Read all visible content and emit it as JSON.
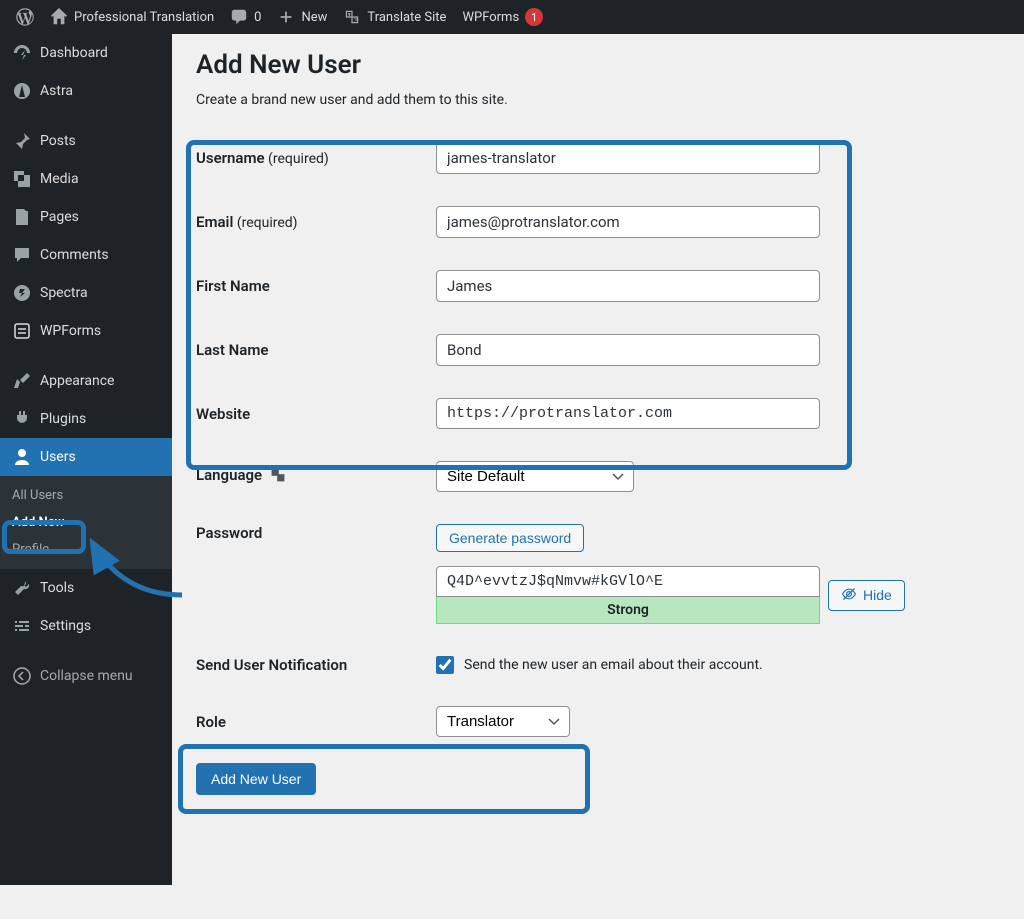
{
  "adminbar": {
    "site_name": "Professional Translation",
    "comments_count": "0",
    "new_label": "New",
    "translate_site_label": "Translate Site",
    "wpforms_label": "WPForms",
    "wpforms_badge": "1"
  },
  "sidebar": {
    "items": [
      {
        "label": "Dashboard"
      },
      {
        "label": "Astra"
      },
      {
        "label": "Posts"
      },
      {
        "label": "Media"
      },
      {
        "label": "Pages"
      },
      {
        "label": "Comments"
      },
      {
        "label": "Spectra"
      },
      {
        "label": "WPForms"
      },
      {
        "label": "Appearance"
      },
      {
        "label": "Plugins"
      },
      {
        "label": "Users"
      },
      {
        "label": "Tools"
      },
      {
        "label": "Settings"
      },
      {
        "label": "Collapse menu"
      }
    ],
    "submenu_users": [
      {
        "label": "All Users"
      },
      {
        "label": "Add New"
      },
      {
        "label": "Profile"
      }
    ]
  },
  "page": {
    "title": "Add New User",
    "subtitle": "Create a brand new user and add them to this site.",
    "labels": {
      "username": "Username",
      "email": "Email",
      "required": " (required)",
      "first_name": "First Name",
      "last_name": "Last Name",
      "website": "Website",
      "language": "Language",
      "password": "Password",
      "generate_password": "Generate password",
      "hide": "Hide",
      "strength": "Strong",
      "send_notification": "Send User Notification",
      "send_notification_desc": "Send the new user an email about their account.",
      "role": "Role",
      "submit": "Add New User"
    },
    "values": {
      "username": "james-translator",
      "email": "james@protranslator.com",
      "first_name": "James",
      "last_name": "Bond",
      "website": "https://protranslator.com",
      "language_selected": "Site Default",
      "password": "Q4D^evvtzJ$qNmvw#kGVlO^E",
      "role_selected": "Translator"
    }
  }
}
